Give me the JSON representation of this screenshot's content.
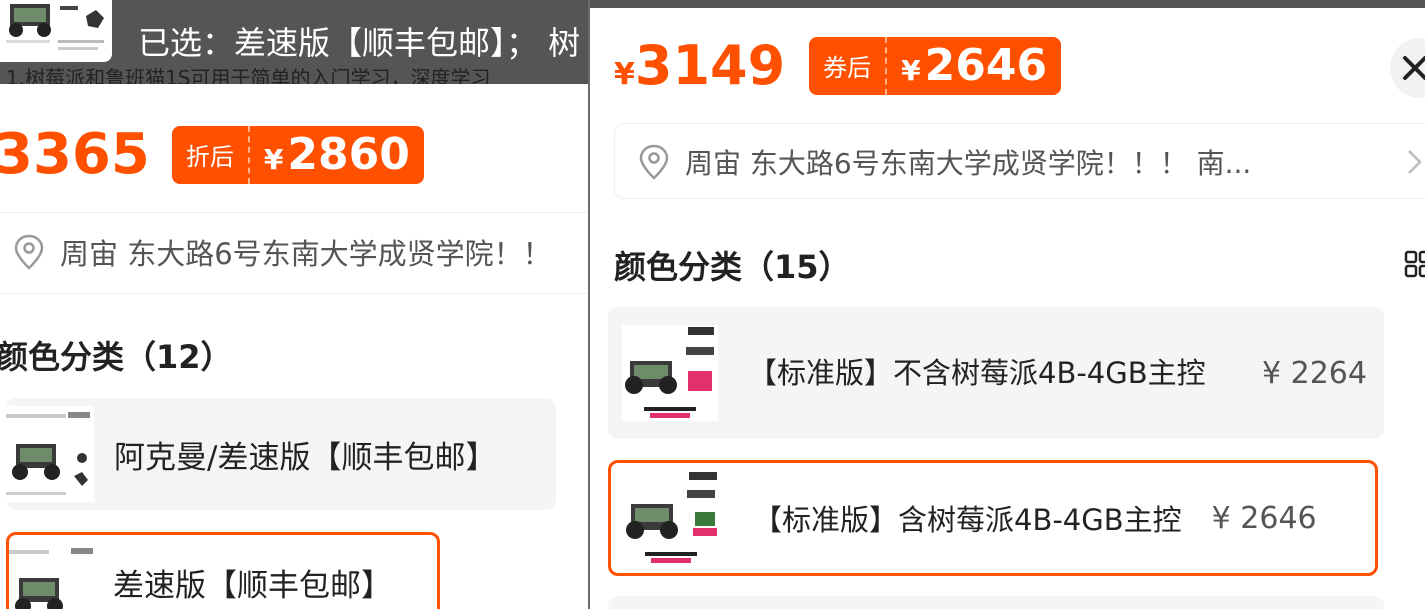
{
  "left": {
    "selected_text": "已选：差速版【顺丰包邮】；  树",
    "desc_text": "1.树莓派和鲁班猫1S可用于简单的入门学习，深度学习",
    "price_original": "3365",
    "discount_tag": "折后",
    "currency": "¥",
    "discount_price": "2860",
    "address": "周宙 东大路6号东南大学成贤学院！！",
    "section_title": "颜色分类（12）",
    "options": [
      {
        "label": "阿克曼/差速版【顺丰包邮】",
        "selected": false
      },
      {
        "label": "差速版【顺丰包邮】",
        "selected": true
      }
    ]
  },
  "right": {
    "currency": "¥",
    "price_original": "3149",
    "coupon_tag": "券后",
    "coupon_price": "2646",
    "address": "周宙 东大路6号东南大学成贤学院！！！ 南...",
    "section_title": "颜色分类（15）",
    "options": [
      {
        "label": "【标准版】不含树莓派4B-4GB主控",
        "price": "¥ 2264",
        "selected": false
      },
      {
        "label": "【标准版】含树莓派4B-4GB主控",
        "price": "¥ 2646",
        "selected": true
      }
    ],
    "icons": {
      "close": "close-icon",
      "grid": "grid-view-icon",
      "chevron": "chevron-right-icon",
      "location": "location-pin-icon"
    }
  },
  "colors": {
    "accent": "#ff5000",
    "text": "#222222",
    "muted": "#555555",
    "option_bg": "#f5f5f5"
  }
}
